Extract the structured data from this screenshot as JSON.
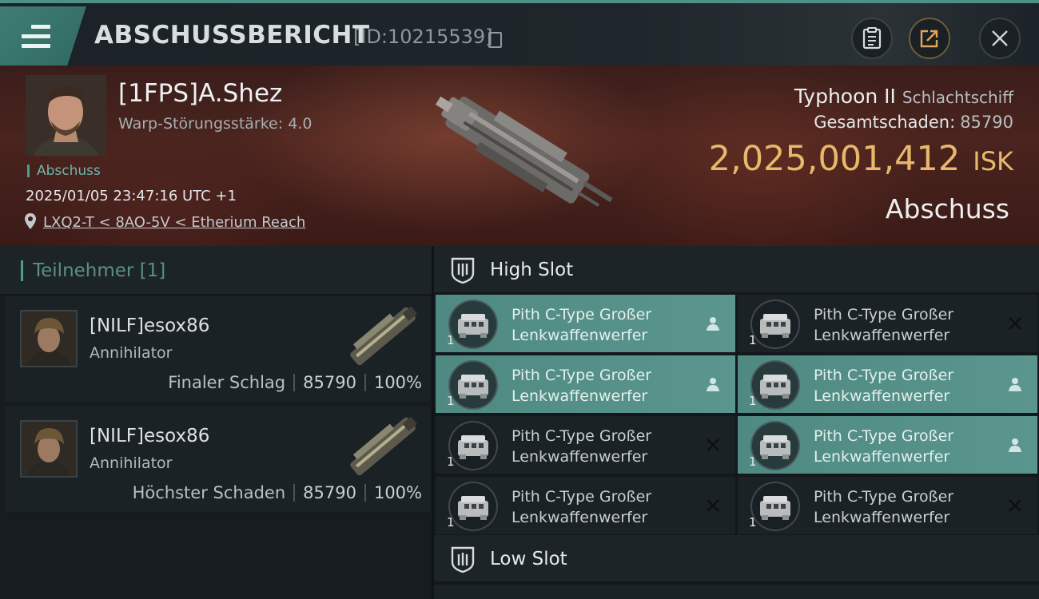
{
  "header": {
    "title": "ABSCHUSSBERICHT",
    "id_text": "[ID:10215539]",
    "icons": [
      "menu-icon",
      "clipboard-icon",
      "export-icon",
      "close-icon"
    ]
  },
  "victim": {
    "name": "[1FPS]A.Shez",
    "warp_strength": "Warp-Störungsstärke: 4.0",
    "tag": "Abschuss",
    "timestamp": "2025/01/05 23:47:16 UTC +1",
    "location": "LXQ2-T < 8AO-5V < Etherium Reach",
    "ship_name": "Typhoon II",
    "ship_class": "Schlachtschiff",
    "total_damage_label": "Gesamtschaden:",
    "total_damage_value": "85790",
    "isk_value": "2,025,001,412",
    "isk_unit": "ISK",
    "result": "Abschuss"
  },
  "participants": {
    "title": "Teilnehmer [1]",
    "items": [
      {
        "name": "[NILF]esox86",
        "ship": "Annihilator",
        "role": "Finaler Schlag",
        "damage": "85790",
        "percent": "100%"
      },
      {
        "name": "[NILF]esox86",
        "ship": "Annihilator",
        "role": "Höchster Schaden",
        "damage": "85790",
        "percent": "100%"
      }
    ]
  },
  "slots": {
    "high_title": "High Slot",
    "low_title": "Low Slot",
    "modules": [
      {
        "name": "Pith C-Type Großer Lenkwaffenwerfer",
        "qty": "1",
        "active": true,
        "status": "person-icon"
      },
      {
        "name": "Pith C-Type Großer Lenkwaffenwerfer",
        "qty": "1",
        "active": false,
        "status": "x-icon"
      },
      {
        "name": "Pith C-Type Großer Lenkwaffenwerfer",
        "qty": "1",
        "active": true,
        "status": "person-icon"
      },
      {
        "name": "Pith C-Type Großer Lenkwaffenwerfer",
        "qty": "1",
        "active": true,
        "status": "person-icon"
      },
      {
        "name": "Pith C-Type Großer Lenkwaffenwerfer",
        "qty": "1",
        "active": false,
        "status": "x-icon"
      },
      {
        "name": "Pith C-Type Großer Lenkwaffenwerfer",
        "qty": "1",
        "active": true,
        "status": "person-icon"
      },
      {
        "name": "Pith C-Type Großer Lenkwaffenwerfer",
        "qty": "1",
        "active": false,
        "status": "x-icon"
      },
      {
        "name": "Pith C-Type Großer Lenkwaffenwerfer",
        "qty": "1",
        "active": false,
        "status": "x-icon"
      }
    ]
  },
  "colors": {
    "accent_teal": "#4e8f86",
    "isk_gold": "#e8b96a",
    "active_module": "#5a968e"
  }
}
